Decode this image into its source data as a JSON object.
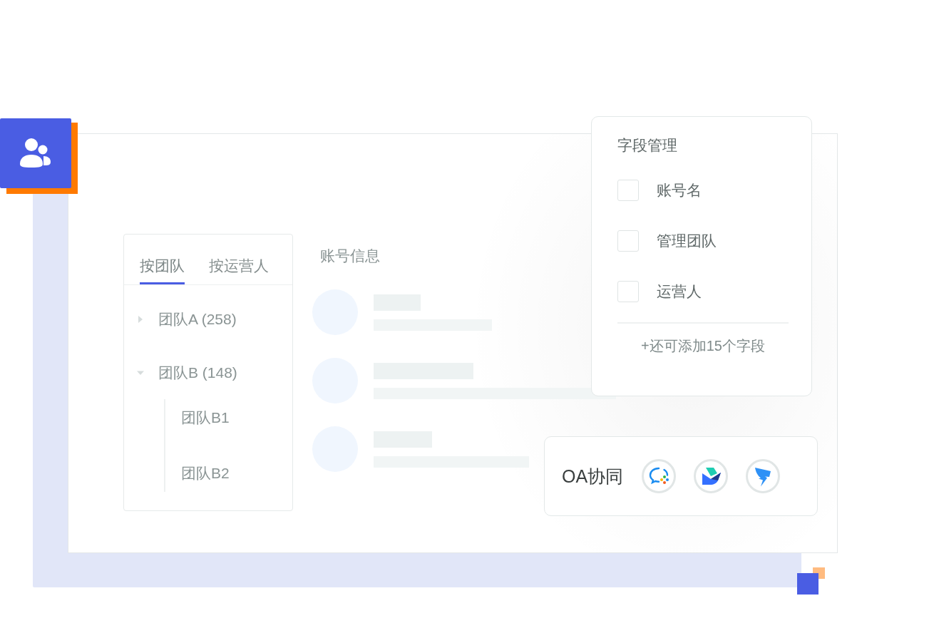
{
  "tabs": [
    {
      "label": "按团队",
      "selected": true
    },
    {
      "label": "按运营人",
      "selected": false
    }
  ],
  "tree": [
    {
      "label": "团队A (258)",
      "expanded": false
    },
    {
      "label": "团队B (148)",
      "expanded": true,
      "children": [
        {
          "label": "团队B1"
        },
        {
          "label": "团队B2"
        }
      ]
    }
  ],
  "account_info": {
    "title": "账号信息"
  },
  "field_manager": {
    "title": "字段管理",
    "fields": [
      {
        "label": "账号名",
        "checked": false
      },
      {
        "label": "管理团队",
        "checked": false
      },
      {
        "label": "运营人",
        "checked": false
      }
    ],
    "footer": "+还可添加15个字段"
  },
  "oa": {
    "label": "OA协同"
  }
}
